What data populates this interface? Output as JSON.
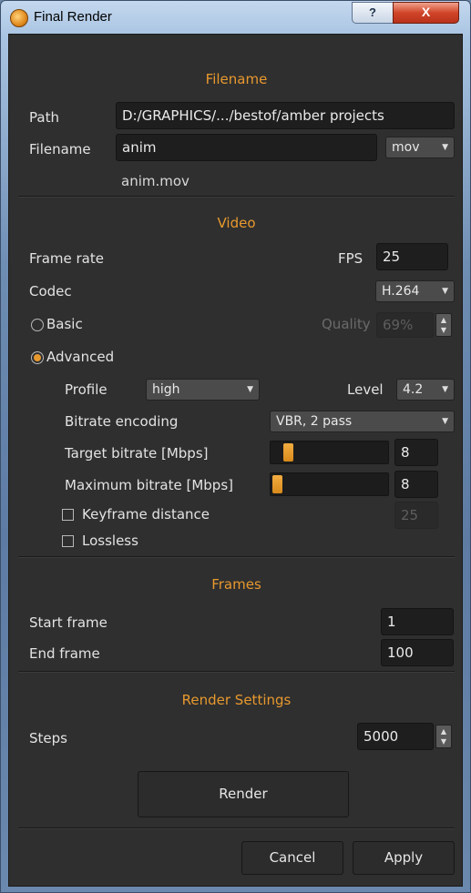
{
  "window": {
    "title": "Final Render",
    "help_label": "?",
    "close_label": "X"
  },
  "filename": {
    "section_title": "Filename",
    "path_label": "Path",
    "path_value": "D:/GRAPHICS/.../bestof/amber projects",
    "filename_label": "Filename",
    "filename_value": "anim",
    "format_value": "mov",
    "preview": "anim.mov"
  },
  "video": {
    "section_title": "Video",
    "frame_rate_label": "Frame rate",
    "fps_label": "FPS",
    "fps_value": "25",
    "codec_label": "Codec",
    "codec_value": "H.264",
    "basic_label": "Basic",
    "quality_label": "Quality",
    "quality_value": "69%",
    "advanced_label": "Advanced",
    "mode_selected": "Advanced",
    "profile_label": "Profile",
    "profile_value": "high",
    "level_label": "Level",
    "level_value": "4.2",
    "bitrate_encoding_label": "Bitrate encoding",
    "bitrate_encoding_value": "VBR, 2 pass",
    "target_bitrate_label": "Target bitrate [Mbps]",
    "target_bitrate_value": "8",
    "max_bitrate_label": "Maximum bitrate [Mbps]",
    "max_bitrate_value": "8",
    "keyframe_label": "Keyframe distance",
    "keyframe_value": "25",
    "keyframe_checked": false,
    "lossless_label": "Lossless",
    "lossless_checked": false
  },
  "frames": {
    "section_title": "Frames",
    "start_label": "Start frame",
    "start_value": "1",
    "end_label": "End frame",
    "end_value": "100"
  },
  "render_settings": {
    "section_title": "Render Settings",
    "steps_label": "Steps",
    "steps_value": "5000"
  },
  "buttons": {
    "render": "Render",
    "cancel": "Cancel",
    "apply": "Apply"
  },
  "colors": {
    "accent": "#e8992e",
    "panel": "#2f2f2f",
    "field": "#1e1e1e"
  },
  "icons": {
    "app": "app-icon",
    "help": "help-icon",
    "close": "close-icon",
    "dropdown": "chevron-down-icon",
    "spin": "spin-arrows-icon"
  }
}
